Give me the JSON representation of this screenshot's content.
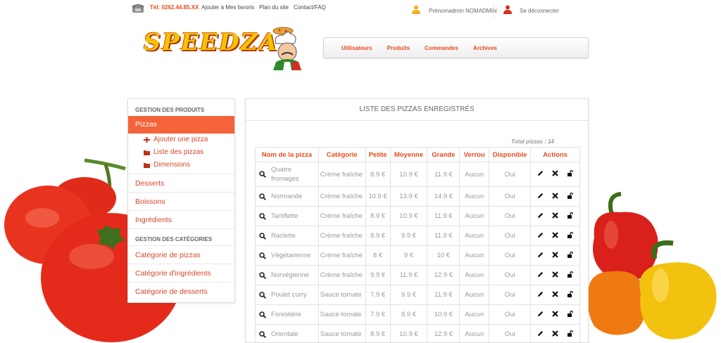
{
  "topbar": {
    "phone": "Tél: 0262.44.85.XX",
    "links": [
      "Ajouter à Mes favoris",
      "Plan du site",
      "Contact/FAQ"
    ],
    "user": "Prénomadmin NOMADMIN",
    "logout": "Se déconnecter"
  },
  "logo": {
    "text": "SPEEDZA"
  },
  "nav": [
    "Utilisateurs",
    "Produits",
    "Commandes",
    "Archives"
  ],
  "sidebar": {
    "section_products": "GESTION DES PRODUITS",
    "active": "Pizzas",
    "sub_items": [
      "Ajouter une pizza",
      "Liste des pizzas",
      "Dimensions"
    ],
    "items": [
      "Desserts",
      "Boissons",
      "Ingrédients"
    ],
    "section_categories": "GESTION DES CATÉGORIES",
    "category_items": [
      "Catégorie de pizzas",
      "Catégorie d'ingrédients",
      "Catégorie de desserts"
    ]
  },
  "main": {
    "title": "LISTE DES PIZZAS ENREGISTRÉS",
    "total": "Total pizzas : 14",
    "columns": [
      "Nom de la pizza",
      "Catégorie",
      "Petite",
      "Moyenne",
      "Grande",
      "Verrou",
      "Disponible",
      "Actions"
    ],
    "rows": [
      [
        "Quatre fromages",
        "Crème fraîche",
        "8.9 €",
        "10.9 €",
        "11.9 €",
        "Aucun",
        "Oui"
      ],
      [
        "Normande",
        "Crème fraîche",
        "10.9 €",
        "13.9 €",
        "14.9 €",
        "Aucun",
        "Oui"
      ],
      [
        "Tartiflette",
        "Crème fraîche",
        "8.9 €",
        "10.9 €",
        "11.9 €",
        "Aucun",
        "Oui"
      ],
      [
        "Raclette",
        "Crème fraîche",
        "8.9 €",
        "9.9 €",
        "11.9 €",
        "Aucun",
        "Oui"
      ],
      [
        "Végétarienne",
        "Crème fraîche",
        "8 €",
        "9 €",
        "10 €",
        "Aucun",
        "Oui"
      ],
      [
        "Norvégienne",
        "Crème fraîche",
        "9.9 €",
        "11.9 €",
        "12.9 €",
        "Aucun",
        "Oui"
      ],
      [
        "Poulet curry",
        "Sauce tomate",
        "7.9 €",
        "9.9 €",
        "11.9 €",
        "Aucun",
        "Oui"
      ],
      [
        "Forestière",
        "Sauce tomate",
        "7.9 €",
        "8.9 €",
        "10.9 €",
        "Aucun",
        "Oui"
      ],
      [
        "Orientale",
        "Sauce tomate",
        "8.9 €",
        "10.9 €",
        "12.9 €",
        "Aucun",
        "Oui"
      ]
    ]
  },
  "colors": {
    "accent": "#e8491d",
    "active_bg": "#f4633a",
    "muted": "#999999"
  }
}
